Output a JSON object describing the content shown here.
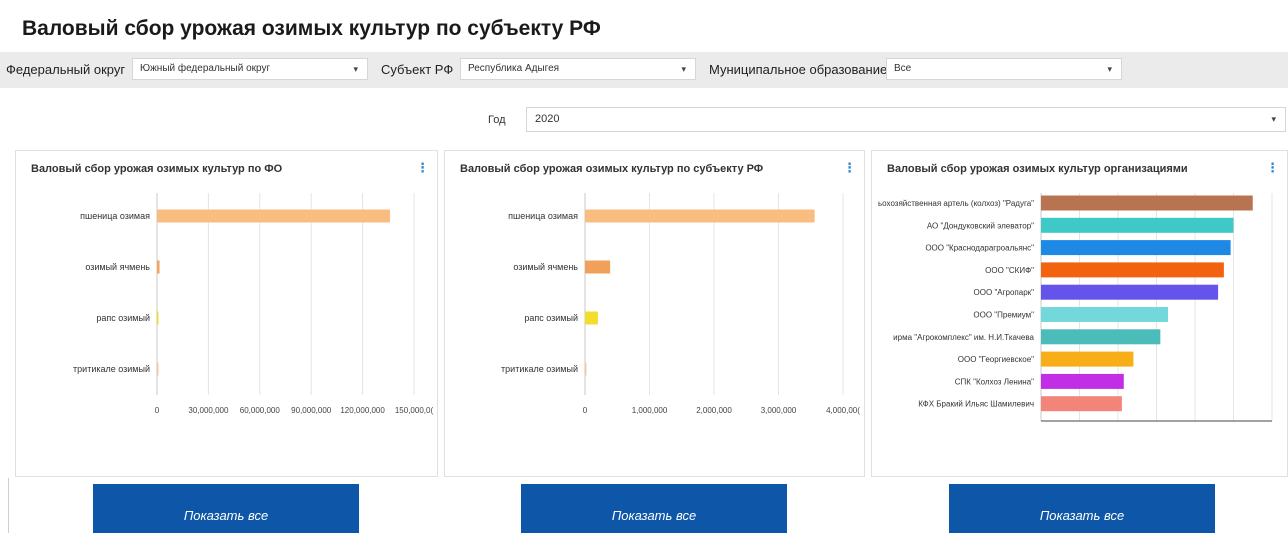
{
  "title": "Валовый сбор урожая озимых культур по субъекту РФ",
  "filters": {
    "district_label": "Федеральный округ",
    "district_value": "Южный федеральный округ",
    "subject_label": "Субъект РФ",
    "subject_value": "Республика Адыгея",
    "municipality_label": "Муниципальное образование",
    "municipality_value": "Все",
    "year_label": "Год",
    "year_value": "2020",
    "caret_icon": "▾"
  },
  "menu_icon": "⋮",
  "show_all_label": "Показать все",
  "chart_data": [
    {
      "type": "bar",
      "title": "Валовый сбор урожая озимых культур по ФО",
      "categories": [
        "пшеница озимая",
        "озимый ячмень",
        "рапс озимый",
        "тритикале озимый"
      ],
      "values": [
        136000000,
        1500000,
        800000,
        200000
      ],
      "colors": [
        "#f9bd82",
        "#f4a560",
        "#f2dc2c",
        "#f6c89e"
      ],
      "xlim": [
        0,
        150000000
      ],
      "ticks": [
        "0",
        "30,000,000",
        "60,000,000",
        "90,000,000",
        "120,000,000",
        "150,000,0("
      ],
      "grid": true
    },
    {
      "type": "bar",
      "title": "Валовый сбор урожая озимых культур по субъекту РФ",
      "categories": [
        "пшеница озимая",
        "озимый ячмень",
        "рапс озимый",
        "тритикале озимый"
      ],
      "values": [
        3560000,
        390000,
        200000,
        10000
      ],
      "colors": [
        "#f9bd82",
        "#f0a05a",
        "#f2dc2c",
        "#f6c89e"
      ],
      "xlim": [
        0,
        4000000
      ],
      "ticks": [
        "0",
        "1,000,000",
        "2,000,000",
        "3,000,000",
        "4,000,00("
      ],
      "grid": true
    },
    {
      "type": "bar",
      "title": "Валовый сбор урожая озимых культур организациями",
      "categories": [
        "ьохозяйственная артель (колхоз) \"Радуга\"",
        "АО \"Дондуковский элеватор\"",
        "ООО \"Краснодарагроальянс\"",
        "ООО \"СКИФ\"",
        "ООО \"Агропарк\"",
        "ООО \"Премиум\"",
        "ирма \"Агрокомплекс\" им. Н.И.Ткачева",
        "ООО \"Георгиевское\"",
        "СПК \"Колхоз Ленина\"",
        "КФХ Бракий Ильяс Шамилевич"
      ],
      "values": [
        110,
        100,
        98.5,
        95,
        92,
        66,
        62,
        48,
        43,
        42
      ],
      "colors": [
        "#b87350",
        "#3ec9c6",
        "#1e88e5",
        "#f2620f",
        "#6454ec",
        "#72d8dc",
        "#4cbcbb",
        "#f8ae16",
        "#c22de6",
        "#f2847a"
      ],
      "xlim": [
        0,
        120
      ],
      "ticks": [],
      "grid": true
    }
  ]
}
